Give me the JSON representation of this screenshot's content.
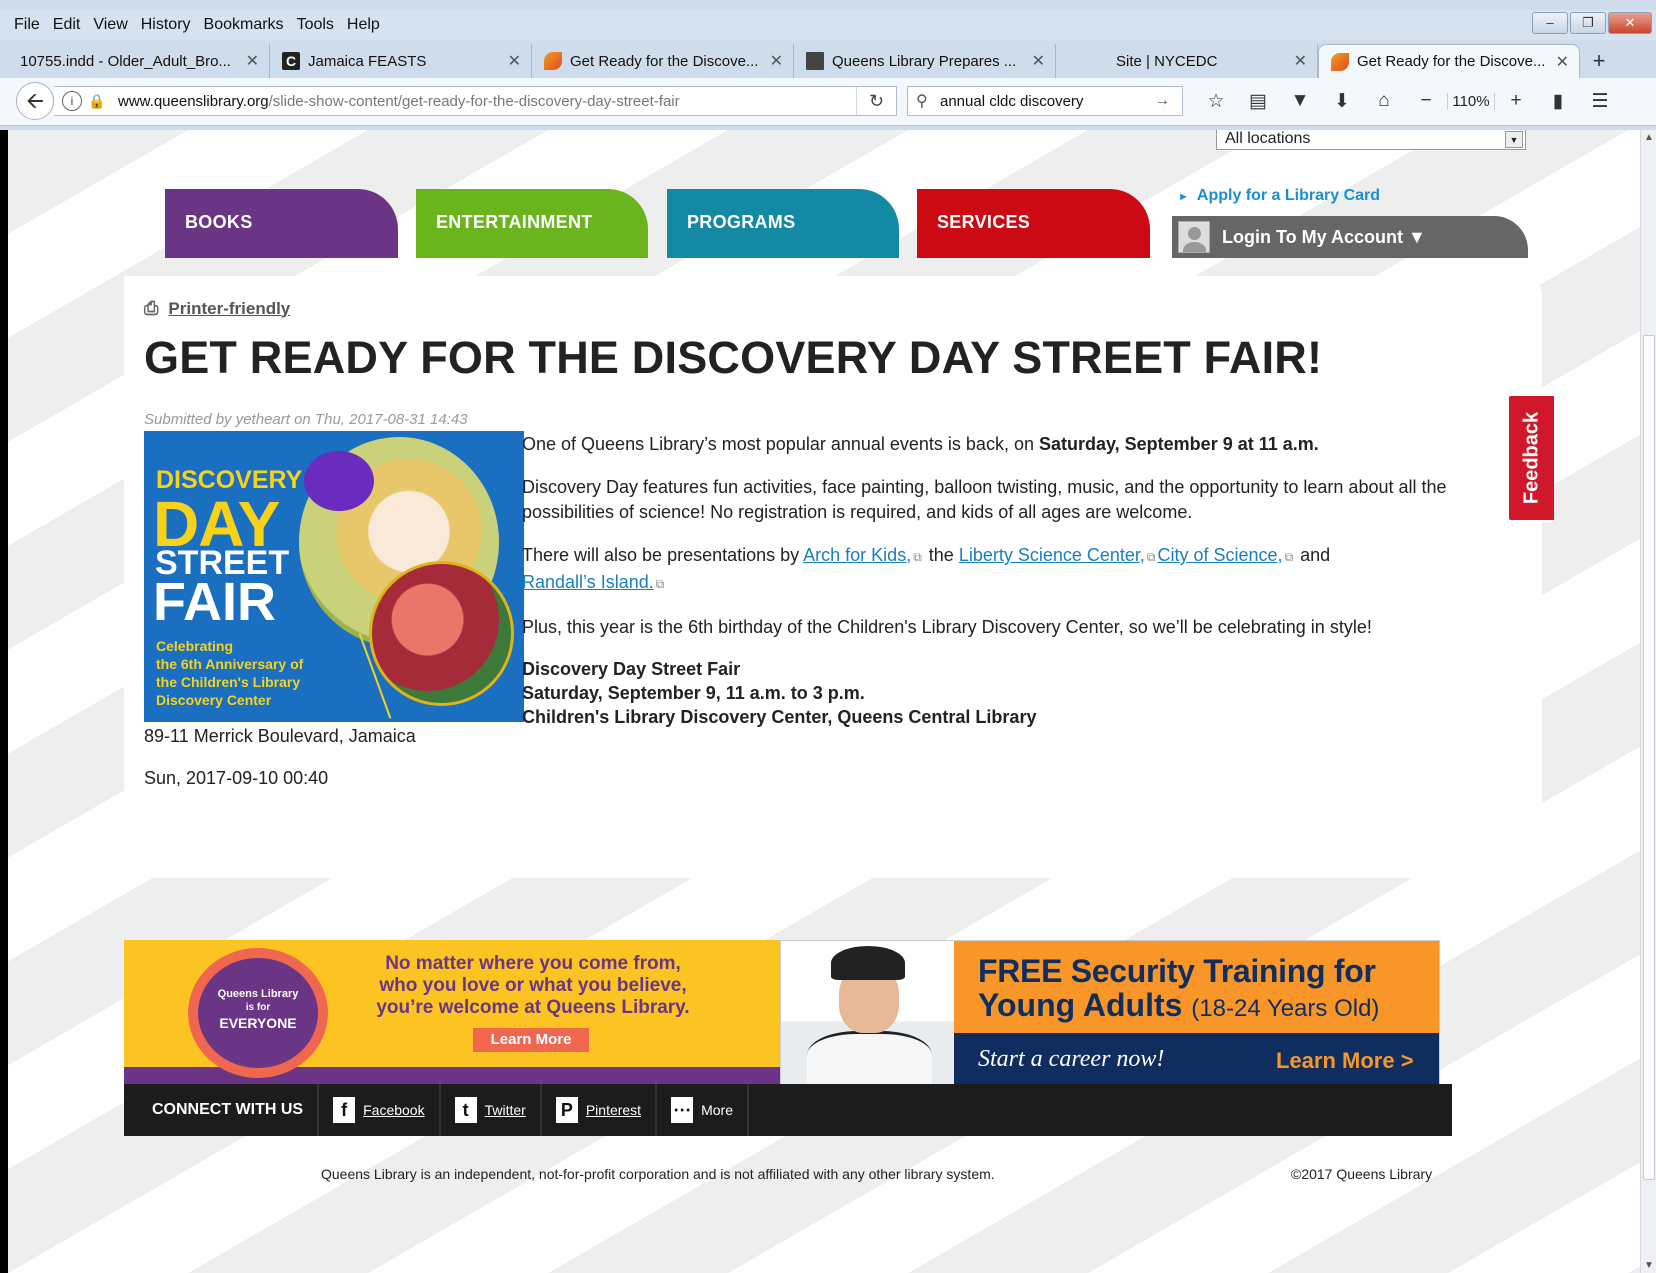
{
  "menu": [
    "File",
    "Edit",
    "View",
    "History",
    "Bookmarks",
    "Tools",
    "Help"
  ],
  "tabs": [
    {
      "label": "10755.indd - Older_Adult_Bro...",
      "icon": "none",
      "active": false
    },
    {
      "label": "Jamaica FEASTS",
      "icon": "c-icon",
      "active": false
    },
    {
      "label": "Get Ready for the Discove...",
      "icon": "queens-library-icon",
      "active": false
    },
    {
      "label": "Queens Library Prepares ...",
      "icon": "pdf-icon",
      "active": false
    },
    {
      "label": "Site | NYCEDC",
      "icon": "none",
      "active": false
    },
    {
      "label": "Get Ready for the Discove...",
      "icon": "queens-library-icon",
      "active": true
    }
  ],
  "url": {
    "domain": "www.queenslibrary.org",
    "path": "/slide-show-content/get-ready-for-the-discovery-day-street-fair"
  },
  "search": {
    "value": "annual cldc discovery"
  },
  "zoom": "110%",
  "page": {
    "location_select": "All locations",
    "nav": {
      "books": "BOOKS",
      "entertainment": "ENTERTAINMENT",
      "programs": "PROGRAMS",
      "services": "SERVICES"
    },
    "apply_link": "Apply for a Library Card",
    "login": "Login To My Account ▼",
    "printer_friendly": "Printer-friendly",
    "title": "GET READY FOR THE DISCOVERY DAY STREET FAIR!",
    "submitted": "Submitted by yetheart on Thu, 2017-08-31 14:43",
    "hero": {
      "line1": "DISCOVERY",
      "line2": "DAY",
      "line3": "STREET",
      "line4": "FAIR",
      "sub": "Celebrating\nthe 6th Anniversary of\nthe Children's Library\nDiscovery Center"
    },
    "p1_text": "One of Queens Library’s most popular annual events is back, on ",
    "p1_bold": "Saturday, September 9 at 11 a.m.",
    "p2": "Discovery Day features fun activities, face painting, balloon twisting, music, and the opportunity to learn about all the possibilities of science! No registration is required, and kids of all ages are welcome.",
    "p3_prefix": "There will also be presentations by ",
    "link_arch": "Arch for Kids,",
    "p3_the": " the ",
    "link_lsc": "Liberty Science Center,",
    "link_cos": "City of Science,",
    "p3_and": " and",
    "link_ri": "Randall’s Island.",
    "p4": "Plus, this year is the 6th birthday of the Children's Library Discovery Center, so we’ll be celebrating in style!",
    "event_name": "Discovery Day Street Fair",
    "event_time": "Saturday, September 9, 11 a.m. to 3 p.m.",
    "event_place": "Children's Library Discovery Center, Queens Central Library",
    "address": "89-11 Merrick Boulevard, Jamaica",
    "date": "Sun, 2017-09-10 00:40",
    "feedback": "Feedback"
  },
  "banner_everyone": {
    "badge1": "Queens Library",
    "badge2": "is for",
    "badge3": "EVERYONE",
    "message": "No matter where you come from,\nwho you love or what you believe,\nyou’re welcome at Queens Library.",
    "button": "Learn More"
  },
  "banner_security": {
    "line1": "FREE Security Training for",
    "line2": "Young Adults",
    "line2_small": "(18-24 Years Old)",
    "tagline": "Start a career now!",
    "cta": "Learn More >"
  },
  "connect": {
    "title": "CONNECT WITH US",
    "facebook": "Facebook",
    "twitter": "Twitter",
    "pinterest": "Pinterest",
    "more": "More"
  },
  "footer": {
    "disclaimer": "Queens Library is an independent, not-for-profit corporation and is not affiliated with any other library system.",
    "copyright": "©2017 Queens Library"
  }
}
